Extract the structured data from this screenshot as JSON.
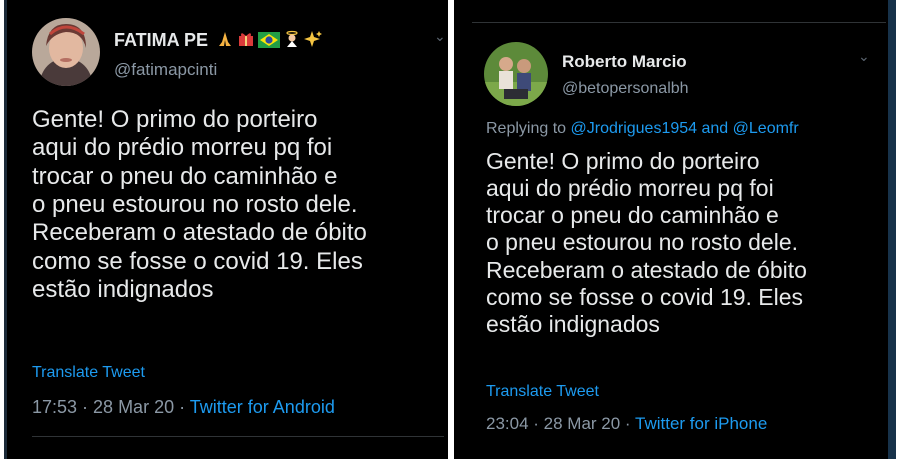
{
  "left_tweet": {
    "author_name": "FATIMA PE",
    "author_handle": "@fatimapcinti",
    "body": "Gente! O primo do porteiro\naqui do prédio morreu pq foi\ntrocar o pneu do caminhão e\no pneu estourou no rosto dele.\nReceberam o atestado de óbito\ncomo se fosse o covid 19. Eles\nestão indignados",
    "translate": "Translate Tweet",
    "time": "17:53 · 28 Mar 20 ·",
    "source": "Twitter for Android",
    "name_emojis": [
      "pray-emoji",
      "gift-emoji",
      "brazil-flag-emoji",
      "angel-emoji",
      "sparkles-emoji"
    ]
  },
  "right_tweet": {
    "author_name": "Roberto Marcio",
    "author_handle": "@betopersonalbh",
    "replying_prefix": "Replying to",
    "reply_to_1": "@Jrodrigues1954",
    "reply_and": "and",
    "reply_to_2": "@Leomfr",
    "body": "Gente! O primo do porteiro\naqui do prédio morreu pq foi\ntrocar o pneu do caminhão e\no pneu estourou no rosto dele.\nReceberam o atestado de óbito\ncomo se fosse o covid 19. Eles\nestão indignados",
    "translate": "Translate Tweet",
    "time": "23:04 · 28 Mar 20 ·",
    "source": "Twitter for iPhone"
  },
  "colors": {
    "background": "#000000",
    "text": "#e7e9ea",
    "secondary": "#8b98a5",
    "link": "#1d9bf0"
  }
}
